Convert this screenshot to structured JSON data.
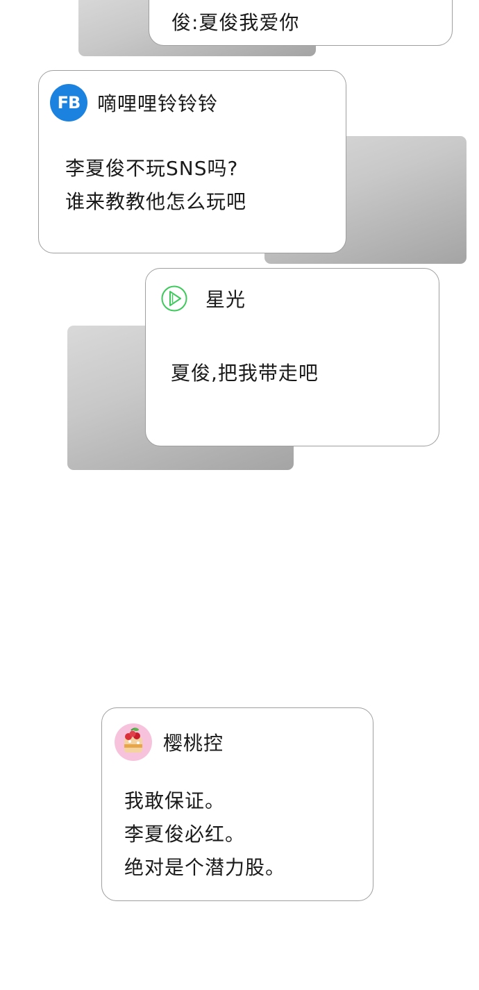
{
  "comments": [
    {
      "text_lines": [
        "俊:夏俊我爱你"
      ]
    },
    {
      "username": "嘀哩哩铃铃铃",
      "avatar_text": "FB",
      "avatar_icon": "fb-avatar-icon",
      "avatar_color": "#1b82e0",
      "text_lines": [
        "李夏俊不玩SNS吗?",
        "谁来教教他怎么玩吧"
      ]
    },
    {
      "username": "星光",
      "avatar_icon": "play-circle-icon",
      "avatar_color": "#3cc95a",
      "text_lines": [
        "夏俊,把我带走吧"
      ]
    },
    {
      "username": "樱桃控",
      "avatar_icon": "cherry-cake-avatar",
      "avatar_color": "#f7c3dc",
      "text_lines": [
        "我敢保证。",
        "李夏俊必红。",
        "绝对是个潜力股。"
      ]
    }
  ]
}
